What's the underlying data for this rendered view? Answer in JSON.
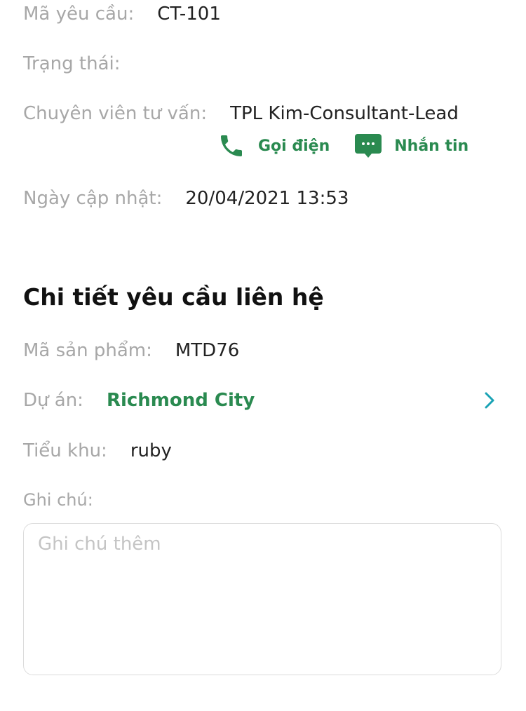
{
  "request_info": {
    "request_code_label": "Mã yêu cầu:",
    "request_code_value": "CT-101",
    "status_label": "Trạng thái:",
    "status_value": "",
    "consultant_label": "Chuyên viên tư vấn:",
    "consultant_value": "TPL Kim-Consultant-Lead",
    "call_label": "Gọi điện",
    "message_label": "Nhắn tin",
    "updated_label": "Ngày cập nhật:",
    "updated_value": "20/04/2021 13:53"
  },
  "detail_section": {
    "title": "Chi tiết yêu cầu liên hệ",
    "product_code_label": "Mã sản phẩm:",
    "product_code_value": "MTD76",
    "project_label": "Dự án:",
    "project_value": "Richmond City",
    "subdivision_label": "Tiểu khu:",
    "subdivision_value": "ruby",
    "note_label": "Ghi chú:",
    "note_placeholder": "Ghi chú thêm",
    "note_value": ""
  },
  "icons": {
    "call": "phone-icon",
    "message": "chat-bubble-icon",
    "project_link": "chevron-right-icon"
  },
  "colors": {
    "accent_green": "#2a8a50",
    "label_gray": "#a7a7a7",
    "chevron_teal": "#1aa3b5"
  }
}
